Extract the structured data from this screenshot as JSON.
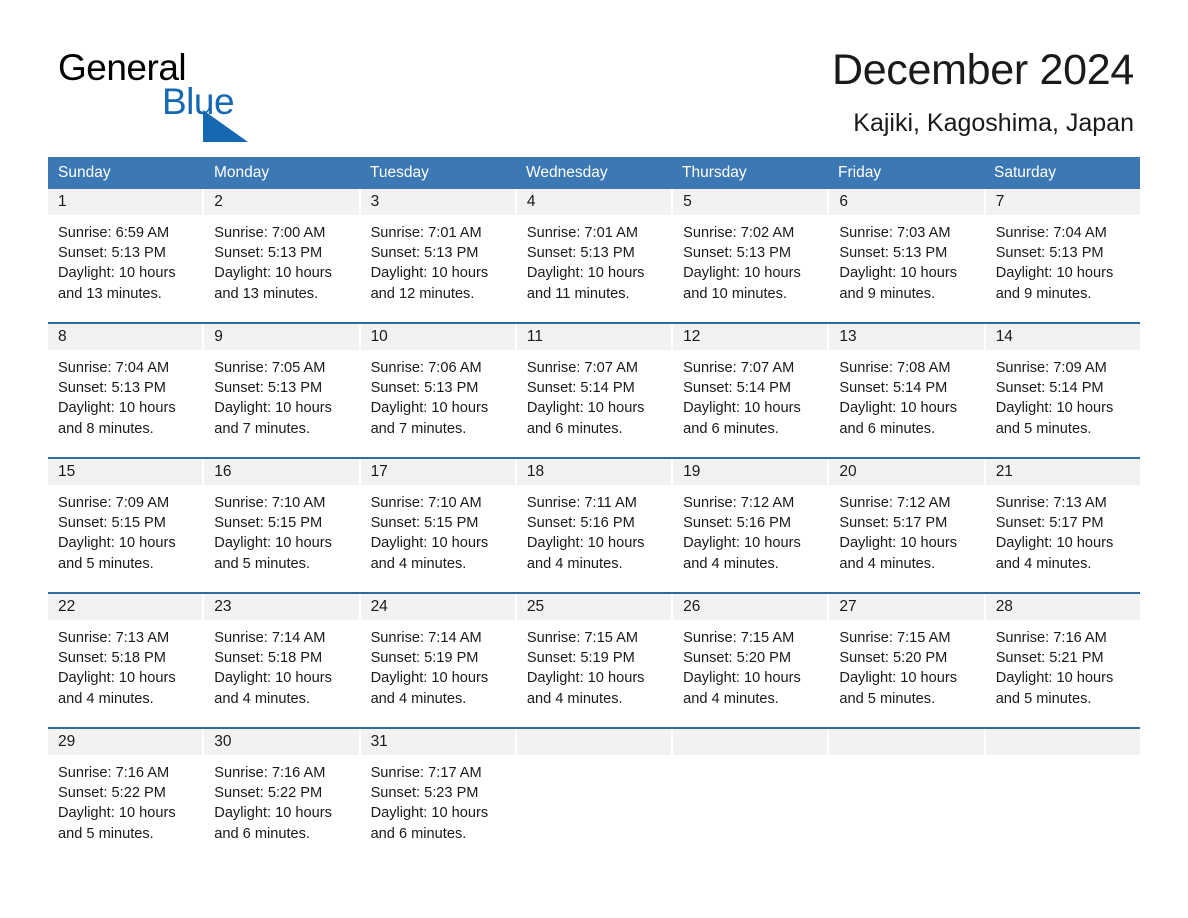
{
  "brand": {
    "name_part1": "General",
    "name_part2": "Blue",
    "accent_color": "#1668b3",
    "triangle_icon": "triangle-icon"
  },
  "header": {
    "title": "December 2024",
    "subtitle": "Kajiki, Kagoshima, Japan"
  },
  "calendar": {
    "header_bg": "#3b78b4",
    "row_border": "#2e6da4",
    "day_strip_bg": "#f2f2f2",
    "weekdays": [
      "Sunday",
      "Monday",
      "Tuesday",
      "Wednesday",
      "Thursday",
      "Friday",
      "Saturday"
    ],
    "weeks": [
      [
        {
          "day": "1",
          "sunrise": "Sunrise: 6:59 AM",
          "sunset": "Sunset: 5:13 PM",
          "daylight_line1": "Daylight: 10 hours",
          "daylight_line2": "and 13 minutes."
        },
        {
          "day": "2",
          "sunrise": "Sunrise: 7:00 AM",
          "sunset": "Sunset: 5:13 PM",
          "daylight_line1": "Daylight: 10 hours",
          "daylight_line2": "and 13 minutes."
        },
        {
          "day": "3",
          "sunrise": "Sunrise: 7:01 AM",
          "sunset": "Sunset: 5:13 PM",
          "daylight_line1": "Daylight: 10 hours",
          "daylight_line2": "and 12 minutes."
        },
        {
          "day": "4",
          "sunrise": "Sunrise: 7:01 AM",
          "sunset": "Sunset: 5:13 PM",
          "daylight_line1": "Daylight: 10 hours",
          "daylight_line2": "and 11 minutes."
        },
        {
          "day": "5",
          "sunrise": "Sunrise: 7:02 AM",
          "sunset": "Sunset: 5:13 PM",
          "daylight_line1": "Daylight: 10 hours",
          "daylight_line2": "and 10 minutes."
        },
        {
          "day": "6",
          "sunrise": "Sunrise: 7:03 AM",
          "sunset": "Sunset: 5:13 PM",
          "daylight_line1": "Daylight: 10 hours",
          "daylight_line2": "and 9 minutes."
        },
        {
          "day": "7",
          "sunrise": "Sunrise: 7:04 AM",
          "sunset": "Sunset: 5:13 PM",
          "daylight_line1": "Daylight: 10 hours",
          "daylight_line2": "and 9 minutes."
        }
      ],
      [
        {
          "day": "8",
          "sunrise": "Sunrise: 7:04 AM",
          "sunset": "Sunset: 5:13 PM",
          "daylight_line1": "Daylight: 10 hours",
          "daylight_line2": "and 8 minutes."
        },
        {
          "day": "9",
          "sunrise": "Sunrise: 7:05 AM",
          "sunset": "Sunset: 5:13 PM",
          "daylight_line1": "Daylight: 10 hours",
          "daylight_line2": "and 7 minutes."
        },
        {
          "day": "10",
          "sunrise": "Sunrise: 7:06 AM",
          "sunset": "Sunset: 5:13 PM",
          "daylight_line1": "Daylight: 10 hours",
          "daylight_line2": "and 7 minutes."
        },
        {
          "day": "11",
          "sunrise": "Sunrise: 7:07 AM",
          "sunset": "Sunset: 5:14 PM",
          "daylight_line1": "Daylight: 10 hours",
          "daylight_line2": "and 6 minutes."
        },
        {
          "day": "12",
          "sunrise": "Sunrise: 7:07 AM",
          "sunset": "Sunset: 5:14 PM",
          "daylight_line1": "Daylight: 10 hours",
          "daylight_line2": "and 6 minutes."
        },
        {
          "day": "13",
          "sunrise": "Sunrise: 7:08 AM",
          "sunset": "Sunset: 5:14 PM",
          "daylight_line1": "Daylight: 10 hours",
          "daylight_line2": "and 6 minutes."
        },
        {
          "day": "14",
          "sunrise": "Sunrise: 7:09 AM",
          "sunset": "Sunset: 5:14 PM",
          "daylight_line1": "Daylight: 10 hours",
          "daylight_line2": "and 5 minutes."
        }
      ],
      [
        {
          "day": "15",
          "sunrise": "Sunrise: 7:09 AM",
          "sunset": "Sunset: 5:15 PM",
          "daylight_line1": "Daylight: 10 hours",
          "daylight_line2": "and 5 minutes."
        },
        {
          "day": "16",
          "sunrise": "Sunrise: 7:10 AM",
          "sunset": "Sunset: 5:15 PM",
          "daylight_line1": "Daylight: 10 hours",
          "daylight_line2": "and 5 minutes."
        },
        {
          "day": "17",
          "sunrise": "Sunrise: 7:10 AM",
          "sunset": "Sunset: 5:15 PM",
          "daylight_line1": "Daylight: 10 hours",
          "daylight_line2": "and 4 minutes."
        },
        {
          "day": "18",
          "sunrise": "Sunrise: 7:11 AM",
          "sunset": "Sunset: 5:16 PM",
          "daylight_line1": "Daylight: 10 hours",
          "daylight_line2": "and 4 minutes."
        },
        {
          "day": "19",
          "sunrise": "Sunrise: 7:12 AM",
          "sunset": "Sunset: 5:16 PM",
          "daylight_line1": "Daylight: 10 hours",
          "daylight_line2": "and 4 minutes."
        },
        {
          "day": "20",
          "sunrise": "Sunrise: 7:12 AM",
          "sunset": "Sunset: 5:17 PM",
          "daylight_line1": "Daylight: 10 hours",
          "daylight_line2": "and 4 minutes."
        },
        {
          "day": "21",
          "sunrise": "Sunrise: 7:13 AM",
          "sunset": "Sunset: 5:17 PM",
          "daylight_line1": "Daylight: 10 hours",
          "daylight_line2": "and 4 minutes."
        }
      ],
      [
        {
          "day": "22",
          "sunrise": "Sunrise: 7:13 AM",
          "sunset": "Sunset: 5:18 PM",
          "daylight_line1": "Daylight: 10 hours",
          "daylight_line2": "and 4 minutes."
        },
        {
          "day": "23",
          "sunrise": "Sunrise: 7:14 AM",
          "sunset": "Sunset: 5:18 PM",
          "daylight_line1": "Daylight: 10 hours",
          "daylight_line2": "and 4 minutes."
        },
        {
          "day": "24",
          "sunrise": "Sunrise: 7:14 AM",
          "sunset": "Sunset: 5:19 PM",
          "daylight_line1": "Daylight: 10 hours",
          "daylight_line2": "and 4 minutes."
        },
        {
          "day": "25",
          "sunrise": "Sunrise: 7:15 AM",
          "sunset": "Sunset: 5:19 PM",
          "daylight_line1": "Daylight: 10 hours",
          "daylight_line2": "and 4 minutes."
        },
        {
          "day": "26",
          "sunrise": "Sunrise: 7:15 AM",
          "sunset": "Sunset: 5:20 PM",
          "daylight_line1": "Daylight: 10 hours",
          "daylight_line2": "and 4 minutes."
        },
        {
          "day": "27",
          "sunrise": "Sunrise: 7:15 AM",
          "sunset": "Sunset: 5:20 PM",
          "daylight_line1": "Daylight: 10 hours",
          "daylight_line2": "and 5 minutes."
        },
        {
          "day": "28",
          "sunrise": "Sunrise: 7:16 AM",
          "sunset": "Sunset: 5:21 PM",
          "daylight_line1": "Daylight: 10 hours",
          "daylight_line2": "and 5 minutes."
        }
      ],
      [
        {
          "day": "29",
          "sunrise": "Sunrise: 7:16 AM",
          "sunset": "Sunset: 5:22 PM",
          "daylight_line1": "Daylight: 10 hours",
          "daylight_line2": "and 5 minutes."
        },
        {
          "day": "30",
          "sunrise": "Sunrise: 7:16 AM",
          "sunset": "Sunset: 5:22 PM",
          "daylight_line1": "Daylight: 10 hours",
          "daylight_line2": "and 6 minutes."
        },
        {
          "day": "31",
          "sunrise": "Sunrise: 7:17 AM",
          "sunset": "Sunset: 5:23 PM",
          "daylight_line1": "Daylight: 10 hours",
          "daylight_line2": "and 6 minutes."
        },
        {
          "day": "",
          "sunrise": "",
          "sunset": "",
          "daylight_line1": "",
          "daylight_line2": ""
        },
        {
          "day": "",
          "sunrise": "",
          "sunset": "",
          "daylight_line1": "",
          "daylight_line2": ""
        },
        {
          "day": "",
          "sunrise": "",
          "sunset": "",
          "daylight_line1": "",
          "daylight_line2": ""
        },
        {
          "day": "",
          "sunrise": "",
          "sunset": "",
          "daylight_line1": "",
          "daylight_line2": ""
        }
      ]
    ]
  }
}
